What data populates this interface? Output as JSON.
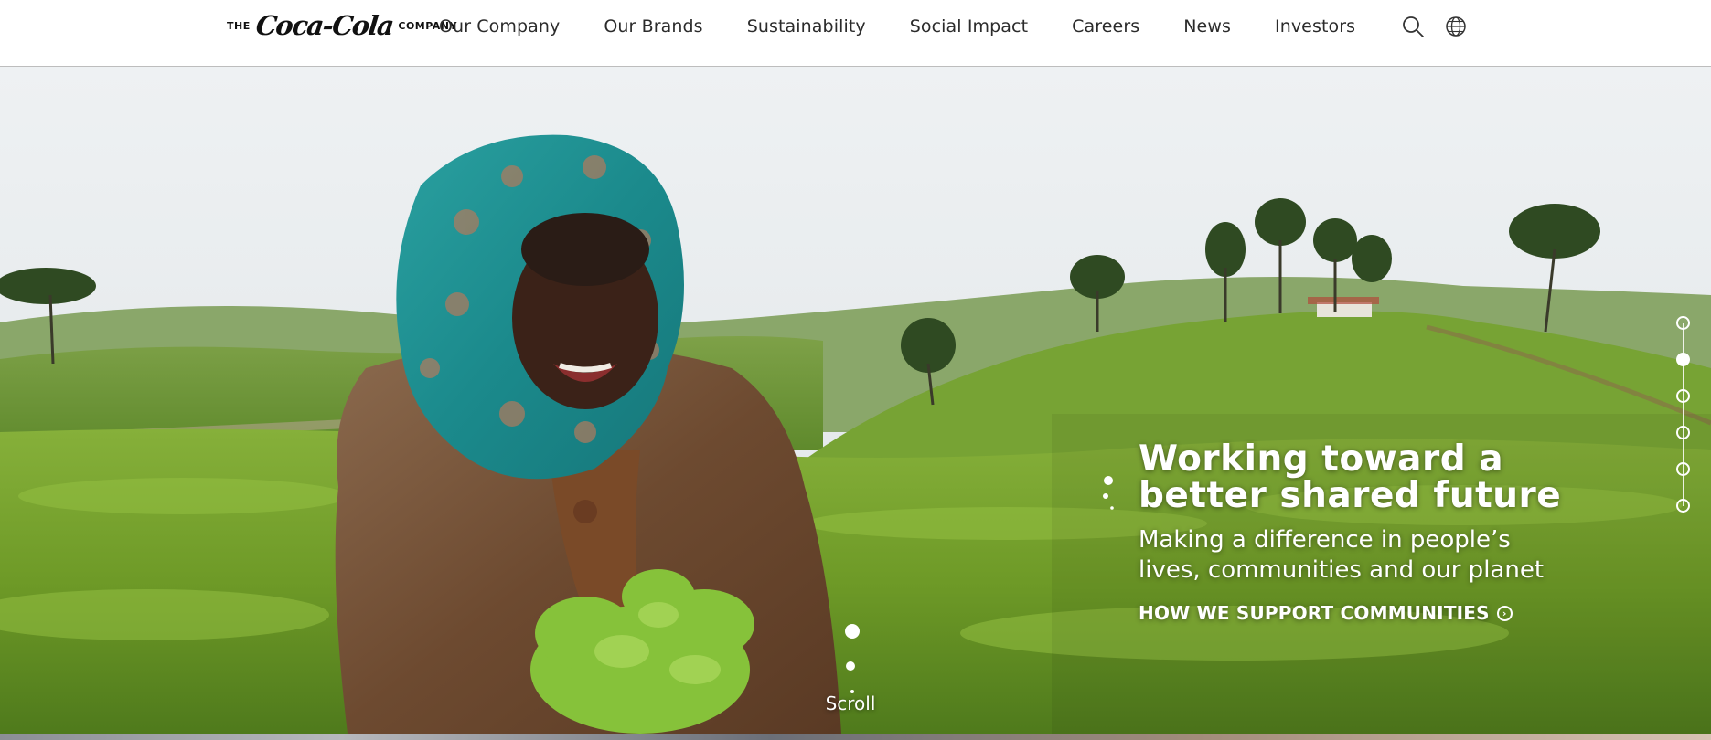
{
  "logo": {
    "pre": "THE",
    "script": "Coca-Cola",
    "post": "COMPANY"
  },
  "nav": [
    {
      "label": "Our Company"
    },
    {
      "label": "Our Brands"
    },
    {
      "label": "Sustainability"
    },
    {
      "label": "Social Impact"
    },
    {
      "label": "Careers"
    },
    {
      "label": "News"
    },
    {
      "label": "Investors"
    }
  ],
  "header_icons": {
    "search": "search-icon",
    "globe": "globe-icon"
  },
  "hero": {
    "title_line1": "Working toward a",
    "title_line2": "better shared future",
    "subtitle_line1": "Making a difference in people’s",
    "subtitle_line2": "lives, communities and our planet",
    "cta_label": "HOW WE SUPPORT COMMUNITIES",
    "cta_icon": "chevron-right-circle-icon",
    "scroll_label": "Scroll",
    "slide_count": 6,
    "active_slide": 2
  },
  "colors": {
    "text_dark": "#2b2b2b",
    "hero_text": "#ffffff",
    "tea_green": "#6f9a2a"
  }
}
